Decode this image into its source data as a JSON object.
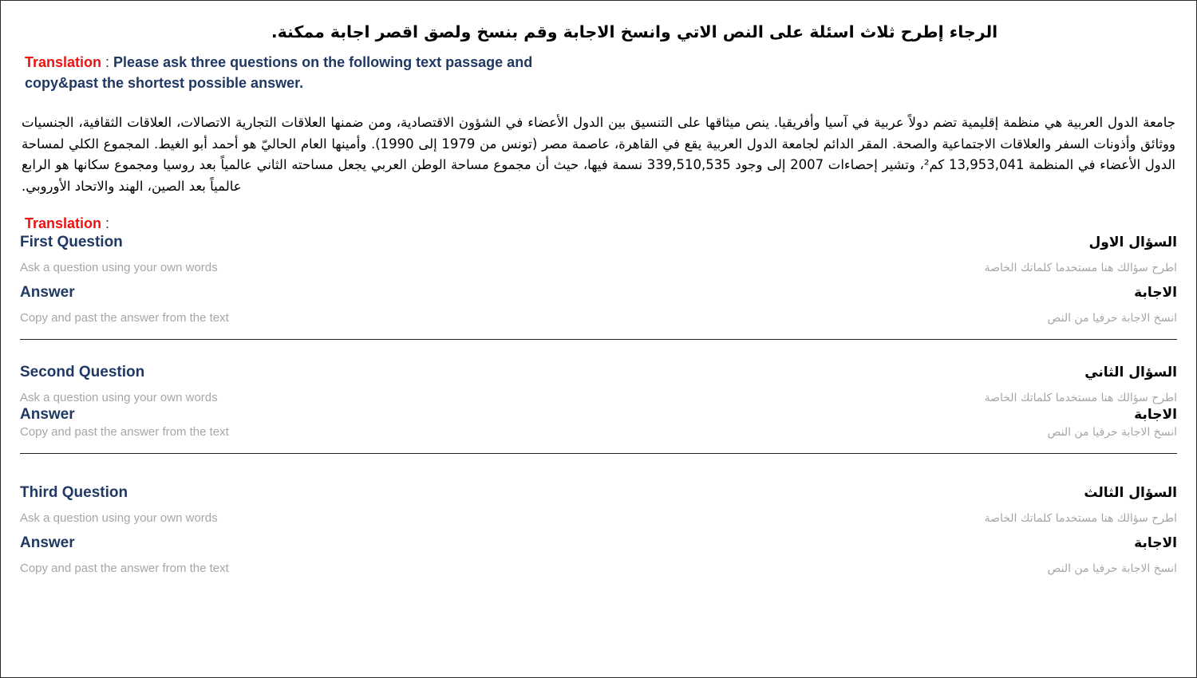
{
  "page": {
    "instruction_ar": "الرجاء إطرح ثلاث اسئلة على النص الاتي وانسخ الاجابة وقم بنسخ ولصق اقصر اجابة ممكنة.",
    "translation_label": "Translation",
    "colon": " : ",
    "instruction_en_line1": "Please ask three questions on the following text passage and",
    "instruction_en_line2": "copy&past the shortest possible answer.",
    "passage_ar": "جامعة الدول العربية هي منظمة إقليمية تضم دولاً عربية في آسيا وأفريقيا. ينص ميثاقها على التنسيق بين الدول الأعضاء في الشؤون الاقتصادية، ومن ضمنها العلاقات التجارية الاتصالات، العلاقات الثقافية، الجنسيات ووثائق وأذونات السفر والعلاقات الاجتماعية والصحة. المقر الدائم لجامعة الدول العربية يقع في القاهرة، عاصمة مصر (تونس من 1979 إلى 1990). وأمينها العام الحاليّ هو أحمد أبو الغيط. المجموع الكلي لمساحة الدول الأعضاء في المنظمة 13,953,041 كم²، وتشير إحصاءات 2007 إلى وجود 339,510,535 نسمة فيها، حيث أن مجموع مساحة الوطن العربي يجعل مساحته الثاني عالمياً بعد روسيا ومجموع سكانها هو الرابع عالمياً بعد الصين، الهند والاتحاد الأوروبي.",
    "section_translation_label": "Translation",
    "colors": {
      "accent_red": "#EE1111",
      "heading_navy": "#1F3864",
      "hint_gray": "#A6A6A6",
      "body_black": "#000000",
      "divider": "#222222",
      "page_border": "#2b2b2b"
    }
  },
  "questions": [
    {
      "question_label_en": "First Question",
      "question_label_ar": "السؤال الاول",
      "question_hint_en": "Ask a question using your own words",
      "question_hint_ar": "اطرح سؤالك هنا مستخدما كلماتك الخاصة",
      "answer_label_en": "Answer",
      "answer_label_ar": "الاجابة",
      "answer_hint_en": "Copy and past the answer from the text",
      "answer_hint_ar": "انسخ الاجابة حرفيا من النص",
      "question_value": "",
      "answer_value": ""
    },
    {
      "question_label_en": "Second Question",
      "question_label_ar": "السؤال الثاني",
      "question_hint_en": "Ask a question using your own words",
      "question_hint_ar": "اطرح سؤالك هنا مستخدما كلماتك الخاصة",
      "answer_label_en": "Answer",
      "answer_label_ar": "الاجابة",
      "answer_hint_en": "Copy and past the answer from the text",
      "answer_hint_ar": "انسخ الاجابة حرفيا من النص",
      "question_value": "",
      "answer_value": ""
    },
    {
      "question_label_en": "Third Question",
      "question_label_ar": "السؤال الثالث",
      "question_hint_en": "Ask a question using your own words",
      "question_hint_ar": "اطرح سؤالك هنا مستخدما كلماتك الخاصة",
      "answer_label_en": "Answer",
      "answer_label_ar": "الاجابة",
      "answer_hint_en": "Copy and past the answer from the text",
      "answer_hint_ar": "انسخ الاجابة حرفيا من النص",
      "question_value": "",
      "answer_value": ""
    }
  ]
}
